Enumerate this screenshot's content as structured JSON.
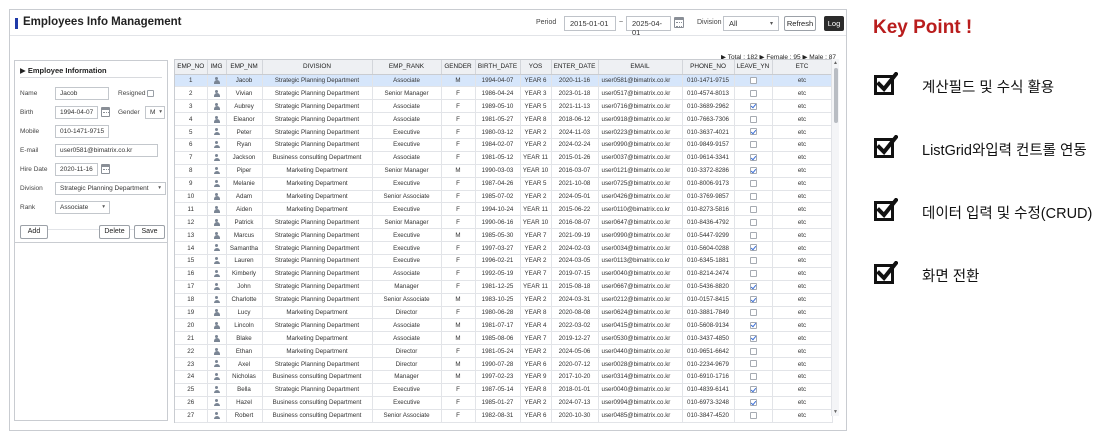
{
  "app": {
    "title": "Employees Info Management",
    "period_label": "Period",
    "period_from": "2015-01-01",
    "period_sep": "~",
    "period_to": "2025-04-01",
    "division_label": "Division",
    "division_value": "All",
    "refresh_label": "Refresh",
    "log_label": "Log",
    "totals_text": "▶ Total : 182 ▶ Female : 95 ▶ Male : 87"
  },
  "form": {
    "title": "▶ Employee Information",
    "name_label": "Name",
    "name_value": "Jacob",
    "resigned_label": "Resigned",
    "birth_label": "Birth",
    "birth_value": "1994-04-07",
    "gender_label": "Gender",
    "gender_value": "M",
    "mobile_label": "Mobile",
    "mobile_value": "010-1471-9715",
    "email_label": "E-mail",
    "email_value": "user0581@bimatrix.co.kr",
    "hire_label": "Hire Date",
    "hire_value": "2020-11-16",
    "division_label": "Division",
    "division_value": "Strategic Planning Department",
    "rank_label": "Rank",
    "rank_value": "Associate",
    "add_label": "Add",
    "delete_label": "Delete",
    "save_label": "Save"
  },
  "grid": {
    "columns": [
      "EMP_NO",
      "IMG",
      "EMP_NM",
      "DIVISION",
      "EMP_RANK",
      "GENDER",
      "BIRTH_DATE",
      "YOS",
      "ENTER_DATE",
      "EMAIL",
      "PHONE_NO",
      "LEAVE_YN",
      "ETC"
    ],
    "rows": [
      {
        "no": "1",
        "name": "Jacob",
        "division": "Strategic Planning Department",
        "rank": "Associate",
        "gender": "M",
        "birth": "1994-04-07",
        "yos": "YEAR 6",
        "enter": "2020-11-16",
        "email": "user0581@bimatrix.co.kr",
        "phone": "010-1471-9715",
        "leave": false,
        "etc": "etc"
      },
      {
        "no": "2",
        "name": "Vivian",
        "division": "Strategic Planning Department",
        "rank": "Senior Manager",
        "gender": "F",
        "birth": "1986-04-24",
        "yos": "YEAR 3",
        "enter": "2023-01-18",
        "email": "user0517@bimatrix.co.kr",
        "phone": "010-4574-8013",
        "leave": false,
        "etc": "etc"
      },
      {
        "no": "3",
        "name": "Aubrey",
        "division": "Strategic Planning Department",
        "rank": "Associate",
        "gender": "F",
        "birth": "1989-05-10",
        "yos": "YEAR 5",
        "enter": "2021-11-13",
        "email": "user0716@bimatrix.co.kr",
        "phone": "010-3689-2962",
        "leave": true,
        "etc": "etc"
      },
      {
        "no": "4",
        "name": "Eleanor",
        "division": "Strategic Planning Department",
        "rank": "Associate",
        "gender": "F",
        "birth": "1981-05-27",
        "yos": "YEAR 8",
        "enter": "2018-06-12",
        "email": "user0918@bimatrix.co.kr",
        "phone": "010-7663-7306",
        "leave": false,
        "etc": "etc"
      },
      {
        "no": "5",
        "name": "Peter",
        "division": "Strategic Planning Department",
        "rank": "Executive",
        "gender": "F",
        "birth": "1980-03-12",
        "yos": "YEAR 2",
        "enter": "2024-11-03",
        "email": "user0223@bimatrix.co.kr",
        "phone": "010-3637-4021",
        "leave": true,
        "etc": "etc"
      },
      {
        "no": "6",
        "name": "Ryan",
        "division": "Strategic Planning Department",
        "rank": "Executive",
        "gender": "F",
        "birth": "1984-02-07",
        "yos": "YEAR 2",
        "enter": "2024-02-24",
        "email": "user0990@bimatrix.co.kr",
        "phone": "010-9849-9157",
        "leave": false,
        "etc": "etc"
      },
      {
        "no": "7",
        "name": "Jackson",
        "division": "Business consulting Department",
        "rank": "Associate",
        "gender": "F",
        "birth": "1981-05-12",
        "yos": "YEAR 11",
        "enter": "2015-01-26",
        "email": "user0037@bimatrix.co.kr",
        "phone": "010-9614-3341",
        "leave": true,
        "etc": "etc"
      },
      {
        "no": "8",
        "name": "Piper",
        "division": "Marketing Department",
        "rank": "Senior Manager",
        "gender": "M",
        "birth": "1990-03-03",
        "yos": "YEAR 10",
        "enter": "2016-03-07",
        "email": "user0121@bimatrix.co.kr",
        "phone": "010-3372-8286",
        "leave": true,
        "etc": "etc"
      },
      {
        "no": "9",
        "name": "Melanie",
        "division": "Marketing Department",
        "rank": "Executive",
        "gender": "F",
        "birth": "1987-04-26",
        "yos": "YEAR 5",
        "enter": "2021-10-08",
        "email": "user0725@bimatrix.co.kr",
        "phone": "010-8006-9173",
        "leave": false,
        "etc": "etc"
      },
      {
        "no": "10",
        "name": "Adam",
        "division": "Marketing Department",
        "rank": "Senior Associate",
        "gender": "F",
        "birth": "1985-07-02",
        "yos": "YEAR 2",
        "enter": "2024-05-01",
        "email": "user0426@bimatrix.co.kr",
        "phone": "010-3769-9857",
        "leave": false,
        "etc": "etc"
      },
      {
        "no": "11",
        "name": "Aiden",
        "division": "Marketing Department",
        "rank": "Executive",
        "gender": "F",
        "birth": "1994-10-24",
        "yos": "YEAR 11",
        "enter": "2015-06-22",
        "email": "user0110@bimatrix.co.kr",
        "phone": "010-8273-5816",
        "leave": false,
        "etc": "etc"
      },
      {
        "no": "12",
        "name": "Patrick",
        "division": "Strategic Planning Department",
        "rank": "Senior Manager",
        "gender": "F",
        "birth": "1990-06-16",
        "yos": "YEAR 10",
        "enter": "2016-08-07",
        "email": "user0647@bimatrix.co.kr",
        "phone": "010-8436-4792",
        "leave": false,
        "etc": "etc"
      },
      {
        "no": "13",
        "name": "Marcus",
        "division": "Strategic Planning Department",
        "rank": "Executive",
        "gender": "M",
        "birth": "1985-05-30",
        "yos": "YEAR 7",
        "enter": "2021-09-19",
        "email": "user0990@bimatrix.co.kr",
        "phone": "010-5447-9299",
        "leave": false,
        "etc": "etc"
      },
      {
        "no": "14",
        "name": "Samantha",
        "division": "Strategic Planning Department",
        "rank": "Executive",
        "gender": "F",
        "birth": "1997-03-27",
        "yos": "YEAR 2",
        "enter": "2024-02-03",
        "email": "user0034@bimatrix.co.kr",
        "phone": "010-5604-0288",
        "leave": true,
        "etc": "etc"
      },
      {
        "no": "15",
        "name": "Lauren",
        "division": "Strategic Planning Department",
        "rank": "Executive",
        "gender": "F",
        "birth": "1996-02-21",
        "yos": "YEAR 2",
        "enter": "2024-03-05",
        "email": "user0113@bimatrix.co.kr",
        "phone": "010-6345-1881",
        "leave": false,
        "etc": "etc"
      },
      {
        "no": "16",
        "name": "Kimberly",
        "division": "Strategic Planning Department",
        "rank": "Associate",
        "gender": "F",
        "birth": "1992-05-19",
        "yos": "YEAR 7",
        "enter": "2019-07-15",
        "email": "user0040@bimatrix.co.kr",
        "phone": "010-8214-2474",
        "leave": false,
        "etc": "etc"
      },
      {
        "no": "17",
        "name": "John",
        "division": "Strategic Planning Department",
        "rank": "Manager",
        "gender": "F",
        "birth": "1981-12-25",
        "yos": "YEAR 11",
        "enter": "2015-08-18",
        "email": "user0667@bimatrix.co.kr",
        "phone": "010-5436-8820",
        "leave": true,
        "etc": "etc"
      },
      {
        "no": "18",
        "name": "Charlotte",
        "division": "Strategic Planning Department",
        "rank": "Senior Associate",
        "gender": "M",
        "birth": "1983-10-25",
        "yos": "YEAR 2",
        "enter": "2024-03-31",
        "email": "user0212@bimatrix.co.kr",
        "phone": "010-0157-8415",
        "leave": true,
        "etc": "etc"
      },
      {
        "no": "19",
        "name": "Lucy",
        "division": "Marketing Department",
        "rank": "Director",
        "gender": "F",
        "birth": "1980-06-28",
        "yos": "YEAR 8",
        "enter": "2020-08-08",
        "email": "user0624@bimatrix.co.kr",
        "phone": "010-3881-7849",
        "leave": false,
        "etc": "etc"
      },
      {
        "no": "20",
        "name": "Lincoln",
        "division": "Strategic Planning Department",
        "rank": "Associate",
        "gender": "M",
        "birth": "1981-07-17",
        "yos": "YEAR 4",
        "enter": "2022-03-02",
        "email": "user0415@bimatrix.co.kr",
        "phone": "010-5608-9134",
        "leave": true,
        "etc": "etc"
      },
      {
        "no": "21",
        "name": "Blake",
        "division": "Marketing Department",
        "rank": "Associate",
        "gender": "M",
        "birth": "1985-08-06",
        "yos": "YEAR 7",
        "enter": "2019-12-27",
        "email": "user0530@bimatrix.co.kr",
        "phone": "010-3437-4850",
        "leave": true,
        "etc": "etc"
      },
      {
        "no": "22",
        "name": "Ethan",
        "division": "Marketing Department",
        "rank": "Director",
        "gender": "F",
        "birth": "1981-05-24",
        "yos": "YEAR 2",
        "enter": "2024-05-06",
        "email": "user0440@bimatrix.co.kr",
        "phone": "010-9651-6642",
        "leave": false,
        "etc": "etc"
      },
      {
        "no": "23",
        "name": "Axel",
        "division": "Strategic Planning Department",
        "rank": "Director",
        "gender": "M",
        "birth": "1990-07-28",
        "yos": "YEAR 6",
        "enter": "2020-07-12",
        "email": "user0028@bimatrix.co.kr",
        "phone": "010-2234-9679",
        "leave": false,
        "etc": "etc"
      },
      {
        "no": "24",
        "name": "Nicholas",
        "division": "Business consulting Department",
        "rank": "Manager",
        "gender": "M",
        "birth": "1997-02-23",
        "yos": "YEAR 9",
        "enter": "2017-10-20",
        "email": "user0314@bimatrix.co.kr",
        "phone": "010-6910-1716",
        "leave": false,
        "etc": "etc"
      },
      {
        "no": "25",
        "name": "Bella",
        "division": "Strategic Planning Department",
        "rank": "Executive",
        "gender": "F",
        "birth": "1987-05-14",
        "yos": "YEAR 8",
        "enter": "2018-01-01",
        "email": "user0040@bimatrix.co.kr",
        "phone": "010-4839-6141",
        "leave": true,
        "etc": "etc"
      },
      {
        "no": "26",
        "name": "Hazel",
        "division": "Business consulting Department",
        "rank": "Executive",
        "gender": "F",
        "birth": "1985-01-27",
        "yos": "YEAR 2",
        "enter": "2024-07-13",
        "email": "user0994@bimatrix.co.kr",
        "phone": "010-6973-3248",
        "leave": true,
        "etc": "etc"
      },
      {
        "no": "27",
        "name": "Robert",
        "division": "Business consulting Department",
        "rank": "Senior Associate",
        "gender": "F",
        "birth": "1982-08-31",
        "yos": "YEAR 6",
        "enter": "2020-10-30",
        "email": "user0485@bimatrix.co.kr",
        "phone": "010-3847-4520",
        "leave": false,
        "etc": "etc"
      }
    ]
  },
  "keypoint": {
    "title": "Key Point !",
    "items": [
      {
        "text": "계산필드 및 수식 활용"
      },
      {
        "text": "ListGrid와입력 컨트롤 연동"
      },
      {
        "text": "데이터 입력 및 수정(CRUD)"
      },
      {
        "text": "화면 전환"
      }
    ]
  },
  "icons": {
    "calendar": "calendar-icon",
    "chevron": "chevron-down-icon",
    "person": "person-icon",
    "check": "checkbox-checked-icon"
  },
  "colors": {
    "accent": "#1f3aa8",
    "keypoint_title": "#b91d1d",
    "selected_row": "#d6e6fb",
    "header_bg": "#eef0f3"
  }
}
